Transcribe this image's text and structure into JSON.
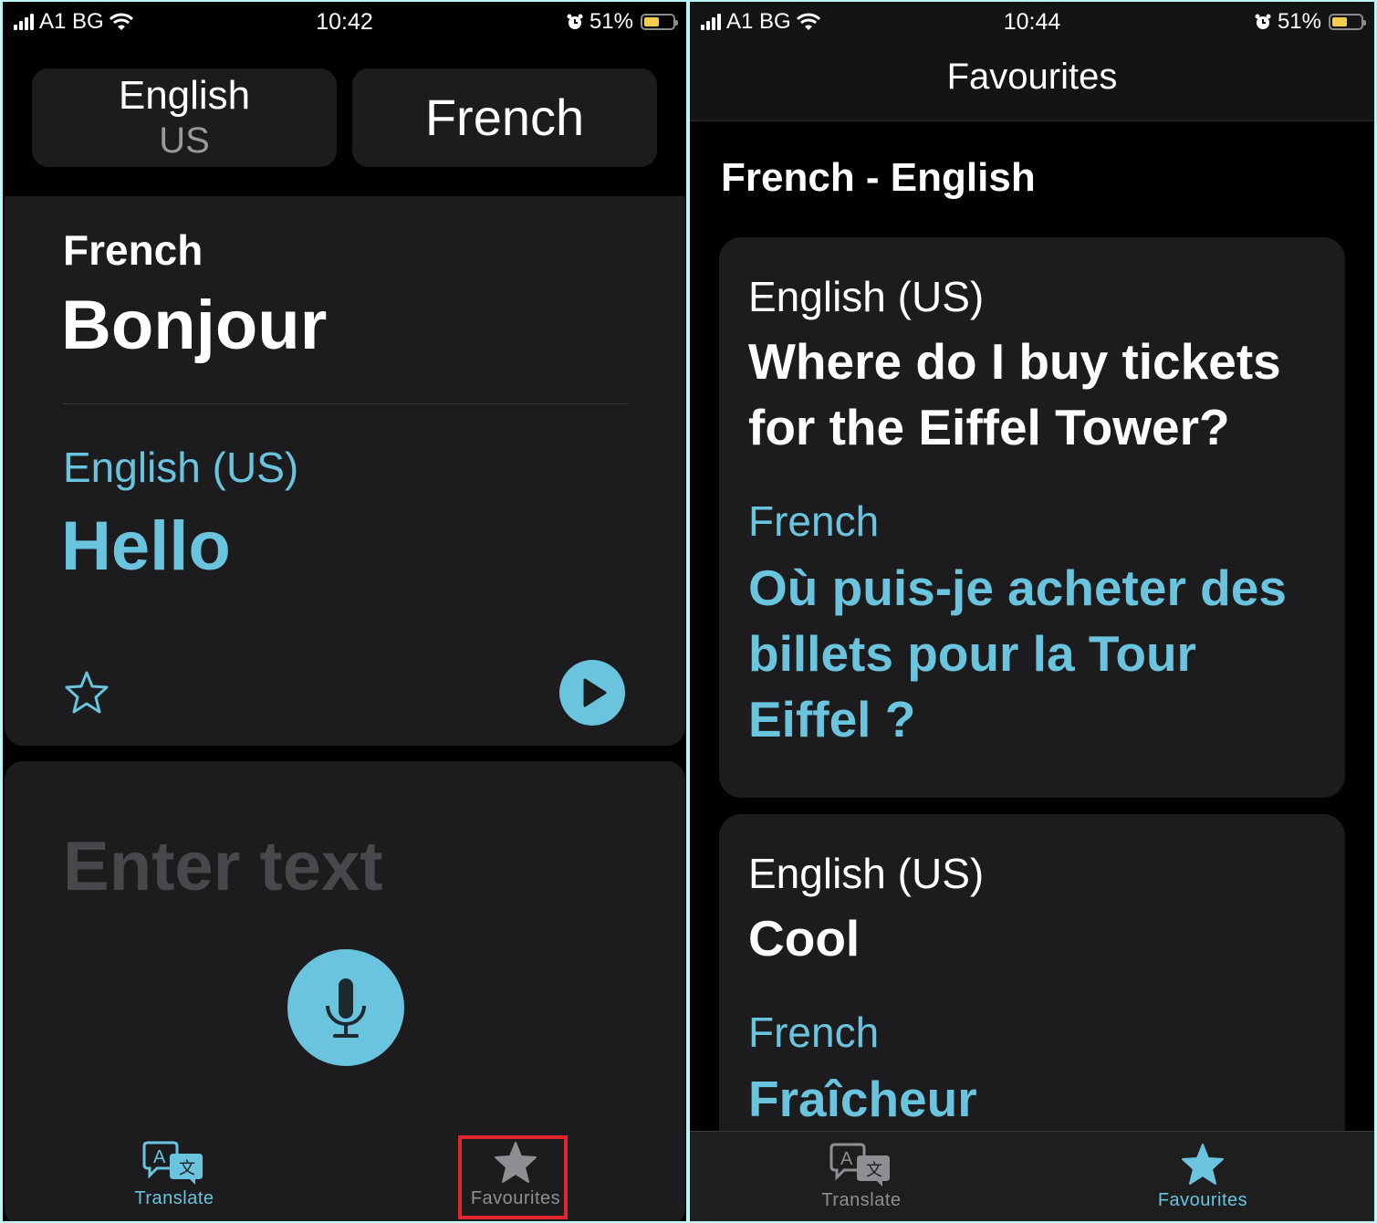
{
  "colors": {
    "accent": "#6ac4de",
    "card_bg": "#1c1c1e",
    "highlight": "#e0262e",
    "battery": "#f3cd4b"
  },
  "left_screen": {
    "status_bar": {
      "carrier": "A1 BG",
      "time": "10:42",
      "battery_percent": "51%",
      "battery_level": 0.51,
      "icons": [
        "signal-icon",
        "wifi-icon",
        "alarm-icon",
        "battery-icon"
      ]
    },
    "language_selector": {
      "source": {
        "name": "English",
        "region": "US"
      },
      "target": {
        "name": "French"
      }
    },
    "result_card": {
      "source_language": "French",
      "source_text": "Bonjour",
      "target_language": "English (US)",
      "target_text": "Hello",
      "favourite_icon": "star-outline-icon",
      "play_icon": "play-icon"
    },
    "input_card": {
      "placeholder": "Enter text",
      "mic_icon": "microphone-icon"
    },
    "tab_bar": {
      "tabs": [
        {
          "label": "Translate",
          "icon": "translate-icon",
          "active": true
        },
        {
          "label": "Favourites",
          "icon": "star-icon",
          "active": false,
          "highlighted": true
        }
      ]
    }
  },
  "right_screen": {
    "status_bar": {
      "carrier": "A1 BG",
      "time": "10:44",
      "battery_percent": "51%",
      "battery_level": 0.51
    },
    "nav_title": "Favourites",
    "section_title": "French - English",
    "favourites": [
      {
        "source_language": "English (US)",
        "source_text": "Where do I buy tickets for the Eiffel Tower?",
        "target_language": "French",
        "target_text": "Où puis-je acheter des billets pour la Tour Eiffel ?"
      },
      {
        "source_language": "English (US)",
        "source_text": "Cool",
        "target_language": "French",
        "target_text": "Fraîcheur"
      }
    ],
    "tab_bar": {
      "tabs": [
        {
          "label": "Translate",
          "icon": "translate-icon",
          "active": false
        },
        {
          "label": "Favourites",
          "icon": "star-icon",
          "active": true
        }
      ]
    }
  }
}
